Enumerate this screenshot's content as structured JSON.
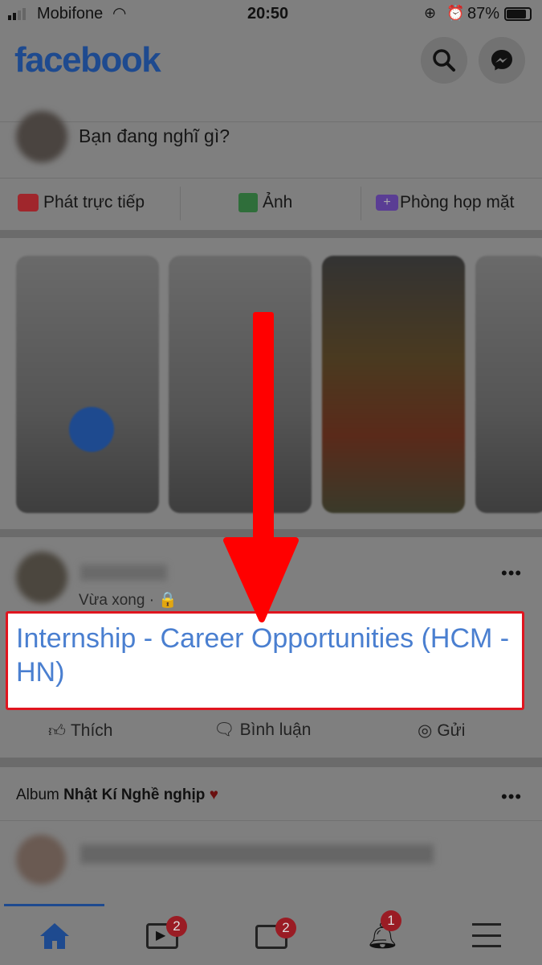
{
  "status_bar": {
    "carrier": "Mobifone",
    "time": "20:50",
    "battery": "87%"
  },
  "header": {
    "logo": "facebook",
    "icons": [
      "search-icon",
      "messenger-icon"
    ]
  },
  "composer": {
    "placeholder": "Bạn đang nghĩ gì?",
    "actions": [
      {
        "label": "Phát trực tiếp",
        "icon": "live-video-icon",
        "color": "#a0262c"
      },
      {
        "label": "Ảnh",
        "icon": "photo-icon",
        "color": "#2f6e3a"
      },
      {
        "label": "Phòng họp mặt",
        "icon": "room-icon",
        "color": "#5a3d94"
      }
    ]
  },
  "post": {
    "time": "Vừa xong",
    "privacy_icon": "lock-icon",
    "text": "Internship - Career Opportunities (HCM - HN)",
    "actions": [
      "Thích",
      "Bình luận",
      "Gửi"
    ]
  },
  "album": {
    "prefix": "Album",
    "name": "Nhật Kí Nghề nghịp",
    "emoji": "♥"
  },
  "bottom_nav": [
    {
      "icon": "home-icon",
      "badge": null
    },
    {
      "icon": "watch-icon",
      "badge": "2"
    },
    {
      "icon": "marketplace-icon",
      "badge": "2"
    },
    {
      "icon": "bell-icon",
      "badge": "1"
    },
    {
      "icon": "menu-icon",
      "badge": null
    }
  ],
  "colors": {
    "annotation": "#ff0000",
    "link": "#4a7fd0"
  }
}
